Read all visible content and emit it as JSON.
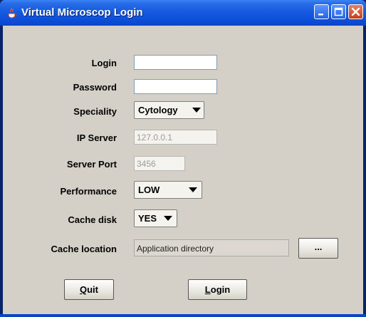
{
  "window": {
    "title": "Virtual Microscop Login",
    "icon": "java-cup-icon",
    "controls": [
      "minimize-icon",
      "maximize-icon",
      "close-icon"
    ],
    "colors": {
      "titlebar": "#0d4ed8",
      "client_bg": "#d4d0c8",
      "close": "#c4401c"
    }
  },
  "form": {
    "login_label": "Login",
    "login_value": "",
    "password_label": "Password",
    "password_value": "",
    "speciality_label": "Speciality",
    "speciality_value": "Cytology",
    "ip_server_label": "IP Server",
    "ip_server_value": "127.0.0.1",
    "server_port_label": "Server Port",
    "server_port_value": "3456",
    "performance_label": "Performance",
    "performance_value": "LOW",
    "cache_disk_label": "Cache disk",
    "cache_disk_value": "YES",
    "cache_location_label": "Cache location",
    "cache_location_value": "Application directory",
    "browse_label": "..."
  },
  "buttons": {
    "quit_mnemonic": "Q",
    "quit_rest": "uit",
    "login_mnemonic": "L",
    "login_rest": "ogin"
  }
}
